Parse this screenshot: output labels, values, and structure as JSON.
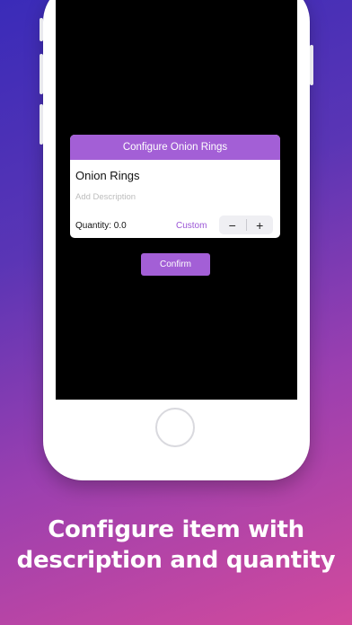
{
  "dialog": {
    "title": "Configure Onion Rings",
    "item_name": "Onion Rings",
    "description_placeholder": "Add Description",
    "quantity_label": "Quantity: 0.0",
    "custom_label": "Custom",
    "decrement_symbol": "−",
    "increment_symbol": "+"
  },
  "confirm_label": "Confirm",
  "caption": {
    "line1": "Configure item with",
    "line2": "description and quantity"
  },
  "colors": {
    "accent": "#a35fd6",
    "screen": "#000000"
  }
}
